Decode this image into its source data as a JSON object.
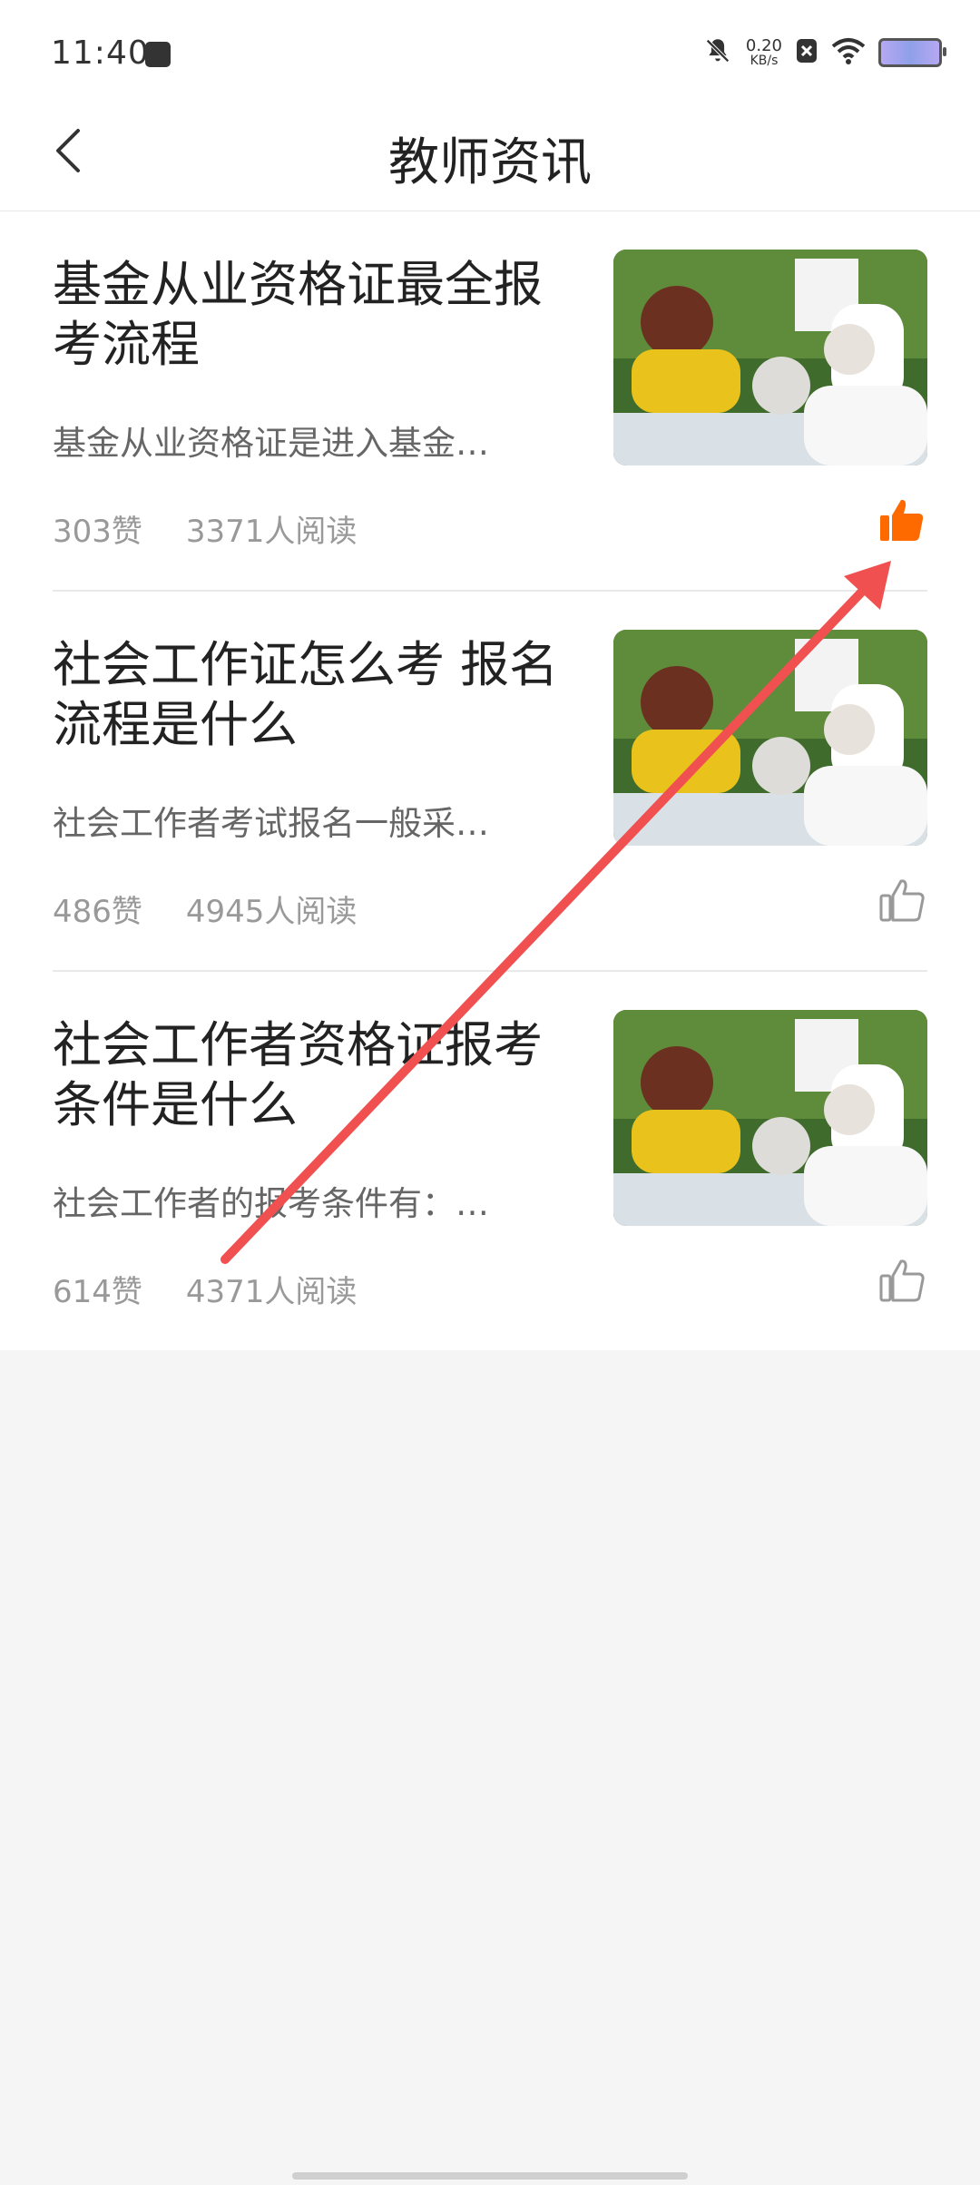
{
  "status_bar": {
    "time": "11:40",
    "net_speed_value": "0.20",
    "net_speed_unit": "KB/s"
  },
  "header": {
    "title": "教师资讯"
  },
  "articles": [
    {
      "title": "基金从业资格证最全报考流程",
      "summary": "基金从业资格证是进入基金…",
      "likes": "303赞",
      "reads": "3371人阅读",
      "liked": true
    },
    {
      "title": "社会工作证怎么考 报名流程是什么",
      "summary": "社会工作者考试报名一般采…",
      "likes": "486赞",
      "reads": "4945人阅读",
      "liked": false
    },
    {
      "title": "社会工作者资格证报考条件是什么",
      "summary": "社会工作者的报考条件有：…",
      "likes": "614赞",
      "reads": "4371人阅读",
      "liked": false
    }
  ],
  "colors": {
    "liked": "#ff6a00",
    "unliked": "#999999",
    "annotation_arrow": "#f05050"
  }
}
